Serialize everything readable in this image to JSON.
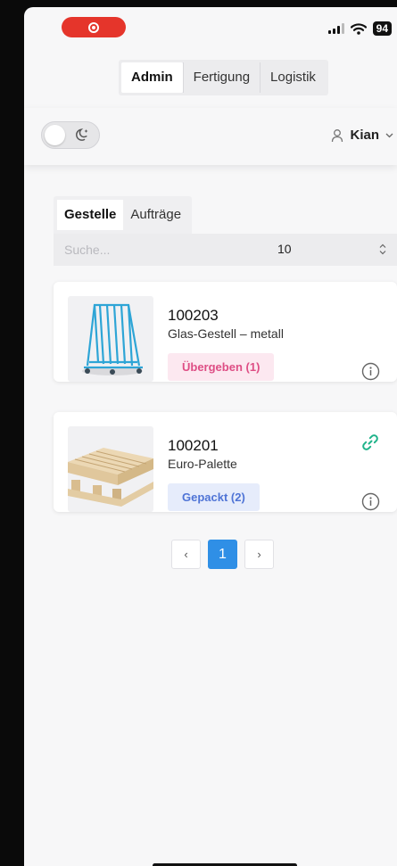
{
  "status_bar": {
    "battery": "94"
  },
  "top_tabs": [
    {
      "label": "Admin",
      "active": true
    },
    {
      "label": "Fertigung",
      "active": false
    },
    {
      "label": "Logistik",
      "active": false
    }
  ],
  "user": {
    "name": "Kian"
  },
  "inner_tabs": [
    {
      "label": "Gestelle",
      "active": true
    },
    {
      "label": "Aufträge",
      "active": false
    }
  ],
  "search": {
    "placeholder": "Suche...",
    "page_size": "10"
  },
  "items": [
    {
      "number": "100203",
      "name": "Glas-Gestell – metall",
      "status": "Übergeben (1)",
      "status_color": "#de4e85",
      "linked": false,
      "image": "glass-rack-image"
    },
    {
      "number": "100201",
      "name": "Euro-Palette",
      "status": "Gepackt (2)",
      "status_color": "#4f74d6",
      "linked": true,
      "image": "euro-pallet-image"
    }
  ],
  "pagination": {
    "prev": "‹",
    "current": "1",
    "next": "›"
  },
  "colors": {
    "accent": "#2f8fe6",
    "link": "#1fb38a",
    "record": "#e5352b"
  }
}
